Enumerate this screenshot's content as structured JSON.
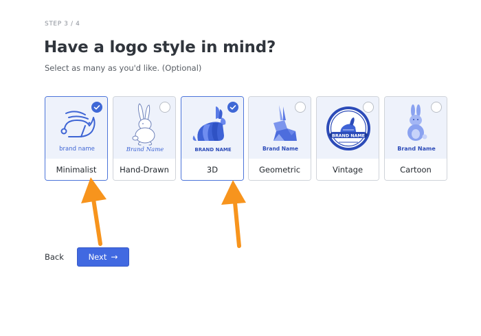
{
  "header": {
    "step": "STEP 3 / 4",
    "title": "Have a logo style in mind?",
    "subtitle": "Select as many as you'd like. (Optional)"
  },
  "styles": [
    {
      "label": "Minimalist",
      "brand": "brand name",
      "selected": true,
      "icon": "rabbit-minimalist-icon"
    },
    {
      "label": "Hand-Drawn",
      "brand": "Brand Name",
      "selected": false,
      "icon": "rabbit-handdrawn-icon"
    },
    {
      "label": "3D",
      "brand": "BRAND NAME",
      "selected": true,
      "icon": "rabbit-3d-icon"
    },
    {
      "label": "Geometric",
      "brand": "Brand Name",
      "selected": false,
      "icon": "rabbit-geometric-icon"
    },
    {
      "label": "Vintage",
      "brand": "BRAND NAME",
      "selected": false,
      "icon": "rabbit-vintage-badge-icon"
    },
    {
      "label": "Cartoon",
      "brand": "Brand Name",
      "selected": false,
      "icon": "rabbit-cartoon-icon"
    }
  ],
  "footer": {
    "back_label": "Back",
    "next_label": "Next",
    "next_icon": "arrow-right-icon"
  },
  "colors": {
    "accent": "#4169e1",
    "card_art_bg": "#eef2fb",
    "annotation_arrow": "#f7941d"
  }
}
